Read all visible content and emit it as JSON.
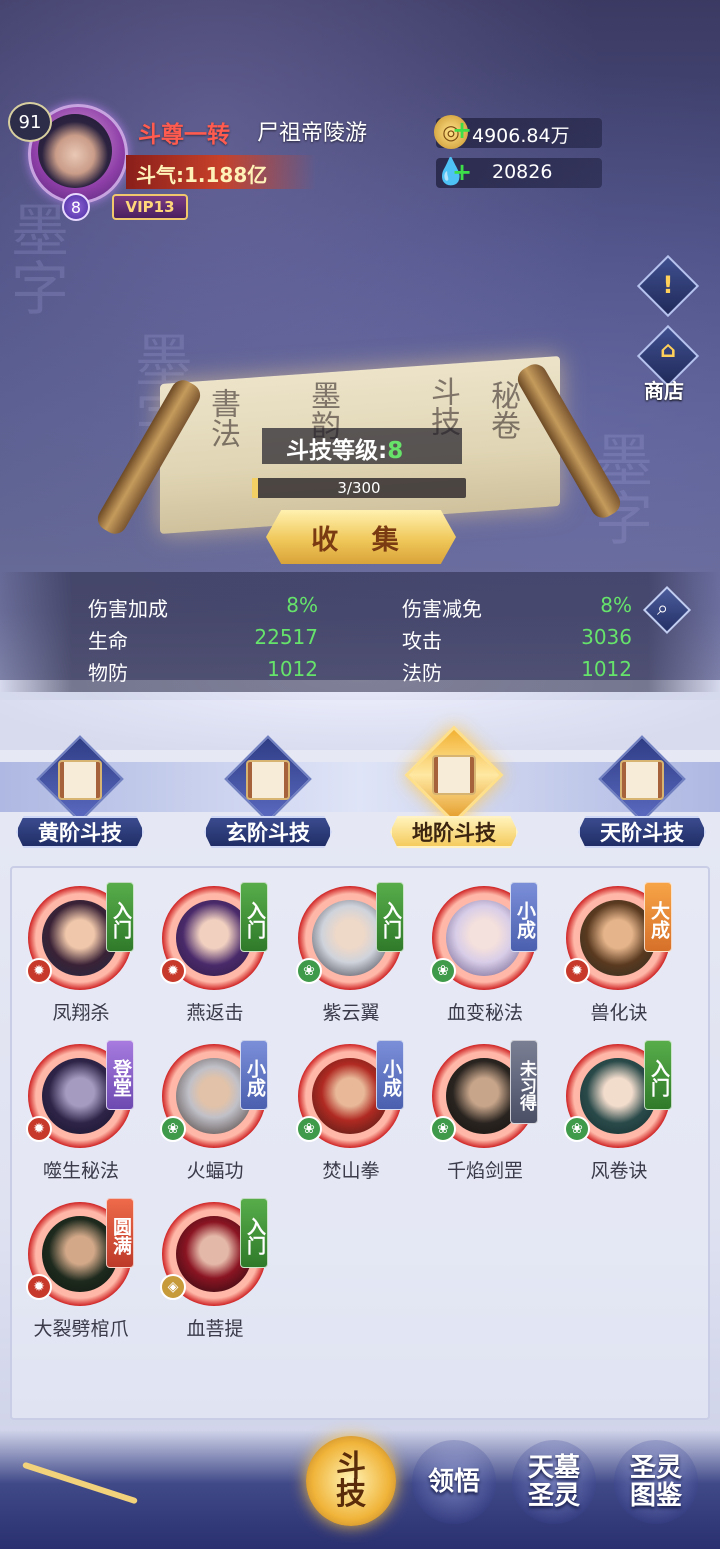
{
  "player": {
    "level": "91",
    "star": "8",
    "vip": "VIP13",
    "rank_title": "斗尊一转",
    "name": "尸祖帝陵游",
    "power": "斗气:1.188亿"
  },
  "resources": {
    "gold": "4906.84万",
    "crystal": "20826"
  },
  "side": {
    "notice_glyph": "!",
    "shop_label": "商店"
  },
  "scroll": {
    "level_label": "斗技等级:",
    "level_value": "8",
    "progress_text": "3/300",
    "progress_fraction": 0.01,
    "collect_label": "收 集"
  },
  "stats": {
    "dmg_bonus_label": "伤害加成",
    "dmg_bonus_value": "8%",
    "dmg_reduce_label": "伤害减免",
    "dmg_reduce_value": "8%",
    "hp_label": "生命",
    "hp_value": "22517",
    "atk_label": "攻击",
    "atk_value": "3036",
    "pdef_label": "物防",
    "pdef_value": "1012",
    "mdef_label": "法防",
    "mdef_value": "1012"
  },
  "tabs": [
    {
      "label": "黄阶斗技",
      "active": false
    },
    {
      "label": "玄阶斗技",
      "active": false
    },
    {
      "label": "地阶斗技",
      "active": true
    },
    {
      "label": "天阶斗技",
      "active": false
    }
  ],
  "skills": [
    {
      "name": "凤翔杀",
      "tag": "入门",
      "tag_color": "green",
      "element": "fire"
    },
    {
      "name": "燕返击",
      "tag": "入门",
      "tag_color": "green",
      "element": "fire"
    },
    {
      "name": "紫云翼",
      "tag": "入门",
      "tag_color": "green",
      "element": "wood"
    },
    {
      "name": "血变秘法",
      "tag": "小成",
      "tag_color": "blue",
      "element": "wood"
    },
    {
      "name": "兽化诀",
      "tag": "大成",
      "tag_color": "orange",
      "element": "fire"
    },
    {
      "name": "噬生秘法",
      "tag": "登堂",
      "tag_color": "purple",
      "element": "fire"
    },
    {
      "name": "火蝠功",
      "tag": "小成",
      "tag_color": "blue",
      "element": "wood"
    },
    {
      "name": "焚山拳",
      "tag": "小成",
      "tag_color": "blue",
      "element": "wood"
    },
    {
      "name": "千焰剑罡",
      "tag": "未习得",
      "tag_color": "gray",
      "element": "wood"
    },
    {
      "name": "风卷诀",
      "tag": "入门",
      "tag_color": "green",
      "element": "wood"
    },
    {
      "name": "大裂劈棺爪",
      "tag": "圆满",
      "tag_color": "red",
      "element": "fire"
    },
    {
      "name": "血菩提",
      "tag": "入门",
      "tag_color": "green",
      "element": "gold"
    }
  ],
  "nav": {
    "skills": "斗技",
    "comprehend": "领悟",
    "tomb": "天墓圣灵",
    "atlas": "圣灵图鉴"
  },
  "colors": {
    "stat_value": "#66e36b",
    "rank_title": "#ff5b4e",
    "active_gold": "#f5cb5e"
  }
}
